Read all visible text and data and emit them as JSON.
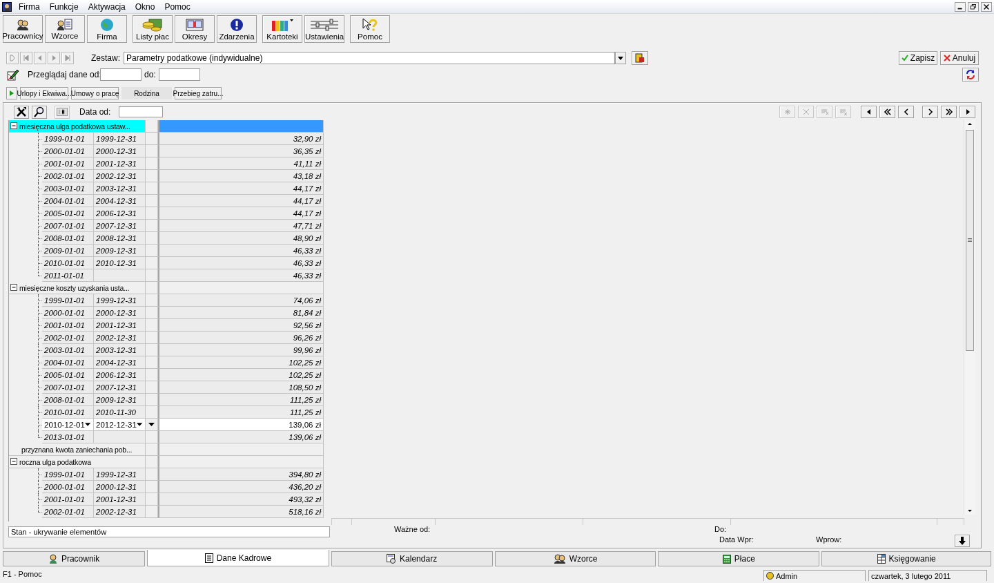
{
  "menu": [
    "Firma",
    "Funkcje",
    "Aktywacja",
    "Okno",
    "Pomoc"
  ],
  "toolbar_groups": [
    {
      "buttons": [
        "Pracownicy",
        "Wzorce",
        "Firma"
      ]
    },
    {
      "buttons": [
        "Listy płac",
        "Okresy",
        "Zdarzenia"
      ]
    },
    {
      "buttons": [
        "Kartoteki",
        "Ustawienia"
      ]
    },
    {
      "buttons": [
        "Pomoc"
      ]
    }
  ],
  "zestaw": {
    "label": "Zestaw:",
    "value": "Parametry podatkowe (indywidualne)"
  },
  "actions": [
    "Zapisz",
    "Anuluj"
  ],
  "browse": {
    "label": "Przeglądaj dane od:",
    "to_label": "do:"
  },
  "subtabs": [
    {
      "label": "Urlopy i Ekwiwa...",
      "selected": false
    },
    {
      "label": "Umowy o pracę",
      "selected": false
    },
    {
      "label": "Rodzina",
      "selected": true
    },
    {
      "label": "Przebieg zatru...",
      "selected": false
    }
  ],
  "tree": {
    "date_label": "Data od:",
    "groups": [
      {
        "label": "miesięczna ulga podatkowa ustaw...",
        "selected": true,
        "expanded": true,
        "children": [
          {
            "from": "1999-01-01",
            "to": "1999-12-31",
            "value": "32,90 zł",
            "editing": false
          },
          {
            "from": "2000-01-01",
            "to": "2000-12-31",
            "value": "36,35 zł",
            "editing": false
          },
          {
            "from": "2001-01-01",
            "to": "2001-12-31",
            "value": "41,11 zł",
            "editing": false
          },
          {
            "from": "2002-01-01",
            "to": "2002-12-31",
            "value": "43,18 zł",
            "editing": false
          },
          {
            "from": "2003-01-01",
            "to": "2003-12-31",
            "value": "44,17 zł",
            "editing": false
          },
          {
            "from": "2004-01-01",
            "to": "2004-12-31",
            "value": "44,17 zł",
            "editing": false
          },
          {
            "from": "2005-01-01",
            "to": "2006-12-31",
            "value": "44,17 zł",
            "editing": false
          },
          {
            "from": "2007-01-01",
            "to": "2007-12-31",
            "value": "47,71 zł",
            "editing": false
          },
          {
            "from": "2008-01-01",
            "to": "2008-12-31",
            "value": "48,90 zł",
            "editing": false
          },
          {
            "from": "2009-01-01",
            "to": "2009-12-31",
            "value": "46,33 zł",
            "editing": false
          },
          {
            "from": "2010-01-01",
            "to": "2010-12-31",
            "value": "46,33 zł",
            "editing": false
          },
          {
            "from": "2011-01-01",
            "value": "46,33 zł",
            "editing": false
          }
        ]
      },
      {
        "label": "miesięczne koszty uzyskania usta...",
        "selected": false,
        "expanded": true,
        "children": [
          {
            "from": "1999-01-01",
            "to": "1999-12-31",
            "value": "74,06 zł",
            "editing": false
          },
          {
            "from": "2000-01-01",
            "to": "2000-12-31",
            "value": "81,84 zł",
            "editing": false
          },
          {
            "from": "2001-01-01",
            "to": "2001-12-31",
            "value": "92,56 zł",
            "editing": false
          },
          {
            "from": "2002-01-01",
            "to": "2002-12-31",
            "value": "96,26 zł",
            "editing": false
          },
          {
            "from": "2003-01-01",
            "to": "2003-12-31",
            "value": "99,96 zł",
            "editing": false
          },
          {
            "from": "2004-01-01",
            "to": "2004-12-31",
            "value": "102,25 zł",
            "editing": false
          },
          {
            "from": "2005-01-01",
            "to": "2006-12-31",
            "value": "102,25 zł",
            "editing": false
          },
          {
            "from": "2007-01-01",
            "to": "2007-12-31",
            "value": "108,50 zł",
            "editing": false
          },
          {
            "from": "2008-01-01",
            "to": "2009-12-31",
            "value": "111,25 zł",
            "editing": false
          },
          {
            "from": "2010-01-01",
            "to": "2010-11-30",
            "value": "111,25 zł",
            "editing": false
          },
          {
            "from": "2010-12-01",
            "to": "2012-12-31",
            "value": "139,06 zł",
            "editing": true
          },
          {
            "from": "2013-01-01",
            "value": "139,06 zł",
            "editing": false
          }
        ]
      },
      {
        "label": "przyznana kwota zaniechania pob...",
        "selected": false
      },
      {
        "label": "roczna ulga podatkowa",
        "selected": false,
        "expanded": true,
        "children": [
          {
            "from": "1999-01-01",
            "to": "1999-12-31",
            "value": "394,80 zł",
            "editing": false
          },
          {
            "from": "2000-01-01",
            "to": "2000-12-31",
            "value": "436,20 zł",
            "editing": false
          },
          {
            "from": "2001-01-01",
            "to": "2001-12-31",
            "value": "493,32 zł",
            "editing": false
          },
          {
            "from": "2002-01-01",
            "to": "2002-12-31",
            "value": "518,16 zł",
            "editing": false
          }
        ]
      }
    ]
  },
  "status_panel": {
    "text": "Stan - ukrywanie elementów"
  },
  "detail_labels": {
    "valid_from": "Ważne od:",
    "to": "Do:",
    "entry_date": "Data Wpr:",
    "entered_by": "Wprow:"
  },
  "bottom_tabs": [
    {
      "label": "Pracownik",
      "selected": false
    },
    {
      "label": "Dane Kadrowe",
      "selected": true
    },
    {
      "label": "Kalendarz",
      "selected": false
    },
    {
      "label": "Wzorce",
      "selected": false
    },
    {
      "label": "Płace",
      "selected": false
    },
    {
      "label": "Księgowanie",
      "selected": false
    }
  ],
  "status_bar": {
    "hint": "F1 - Pomoc",
    "user": "Admin",
    "date": "czwartek, 3 lutego 2011"
  }
}
